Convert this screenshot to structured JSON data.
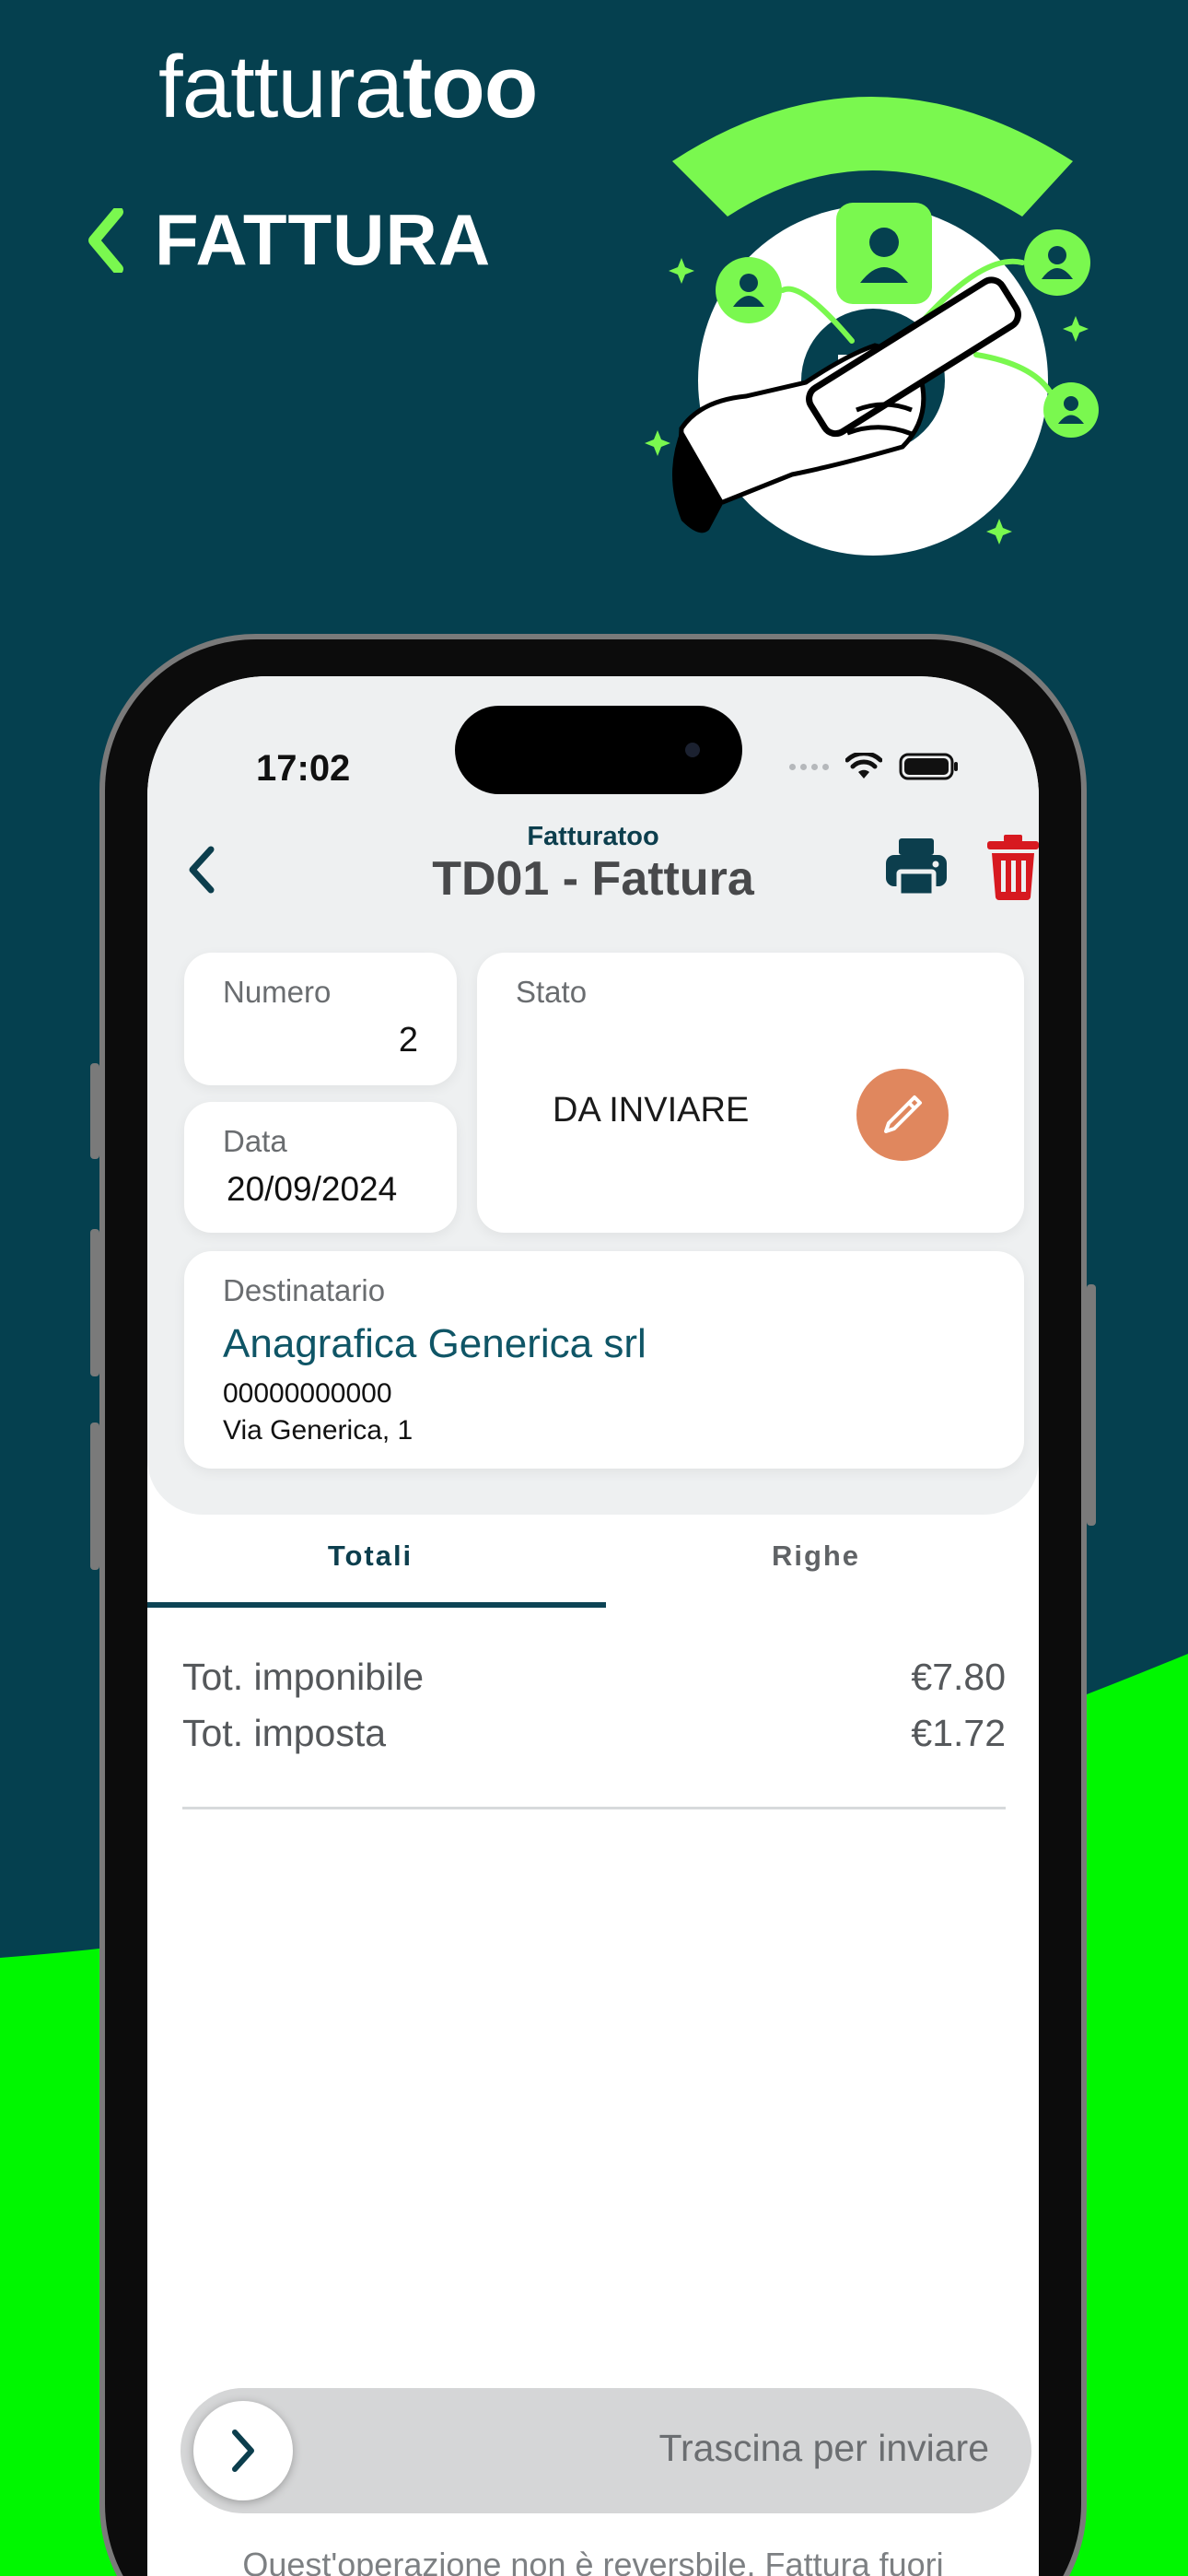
{
  "colors": {
    "background": "#05404f",
    "accent_green": "#00f700",
    "brand_green": "#7af84f",
    "edit_orange": "#e0875e",
    "delete_red": "#d71920"
  },
  "promo": {
    "brand_light": "fattura",
    "brand_bold": "too",
    "title": "FATTURA"
  },
  "status_bar": {
    "time": "17:02"
  },
  "nav": {
    "subtitle": "Fatturatoo",
    "title": "TD01 - Fattura"
  },
  "invoice": {
    "numero_label": "Numero",
    "numero_value": "2",
    "data_label": "Data",
    "data_value": "20/09/2024",
    "stato_label": "Stato",
    "stato_value": "DA INVIARE",
    "dest_label": "Destinatario",
    "dest_name": "Anagrafica Generica srl",
    "dest_vat": "00000000000",
    "dest_address": "Via Generica, 1"
  },
  "tabs": [
    {
      "label": "Totali",
      "active": true
    },
    {
      "label": "Righe",
      "active": false
    }
  ],
  "totals": [
    {
      "label": "Tot. imponibile",
      "value": "€7.80"
    },
    {
      "label": "Tot. imposta",
      "value": "€1.72"
    }
  ],
  "slider": {
    "label": "Trascina per inviare"
  },
  "note": "Quest'operazione non è reversbile. Fattura fuori"
}
